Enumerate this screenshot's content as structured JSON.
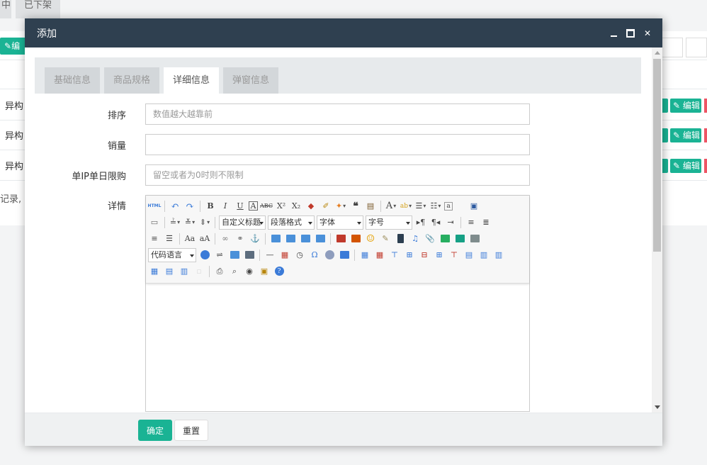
{
  "background": {
    "tabs": [
      "中",
      "已下架"
    ],
    "edit_button_top": "编",
    "rows": [
      {
        "name": "异构",
        "edit_label": "编辑"
      },
      {
        "name": "异构",
        "edit_label": "编辑"
      },
      {
        "name": "异构",
        "edit_label": "编辑"
      }
    ],
    "footer_text": "记录,"
  },
  "modal": {
    "title": "添加",
    "tabs": [
      {
        "label": "基础信息",
        "active": false
      },
      {
        "label": "商品规格",
        "active": false
      },
      {
        "label": "详细信息",
        "active": true
      },
      {
        "label": "弹窗信息",
        "active": false
      }
    ],
    "fields": {
      "sort": {
        "label": "排序",
        "placeholder": "数值越大越靠前",
        "value": ""
      },
      "sales": {
        "label": "销量",
        "placeholder": "",
        "value": ""
      },
      "limit": {
        "label": "单IP单日限购",
        "placeholder": "留空或者为0时则不限制",
        "value": ""
      },
      "detail": {
        "label": "详情"
      }
    },
    "editor": {
      "html_label": "HTML",
      "selects": {
        "custom_heading": "自定义标题",
        "paragraph": "段落格式",
        "font": "字体",
        "font_size": "字号",
        "code_lang": "代码语言"
      }
    },
    "buttons": {
      "confirm": "确定",
      "reset": "重置"
    }
  },
  "colors": {
    "header": "#2f4050",
    "primary": "#1ab394",
    "danger": "#ed5565"
  }
}
